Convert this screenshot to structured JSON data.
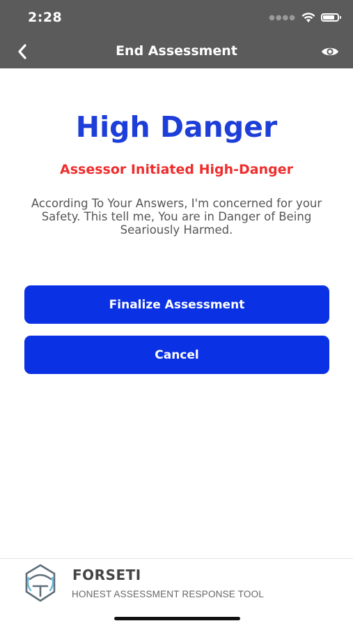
{
  "status_bar": {
    "time": "2:28",
    "signal_icon": "signal-dots-icon",
    "wifi_icon": "wifi-icon",
    "battery_icon": "battery-icon",
    "battery_level": 0.8
  },
  "nav": {
    "title": "End Assessment",
    "back_icon": "chevron-left-icon",
    "view_icon": "eye-icon"
  },
  "result": {
    "title": "High Danger",
    "subtitle": "Assessor Initiated High-Danger",
    "message": "According To Your Answers, I'm concerned for your Safety. This tell me, You are in Danger of Being Seariously Harmed."
  },
  "actions": {
    "finalize_label": "Finalize Assessment",
    "cancel_label": "Cancel"
  },
  "footer": {
    "brand_name": "FORSETI",
    "tagline": "HONEST ASSESSMENT RESPONSE TOOL",
    "logo_icon": "forseti-logo-icon"
  },
  "colors": {
    "header_bg": "#5b5b5b",
    "title": "#1d3ed8",
    "subtitle": "#ef2d2d",
    "button": "#0b31e5"
  }
}
